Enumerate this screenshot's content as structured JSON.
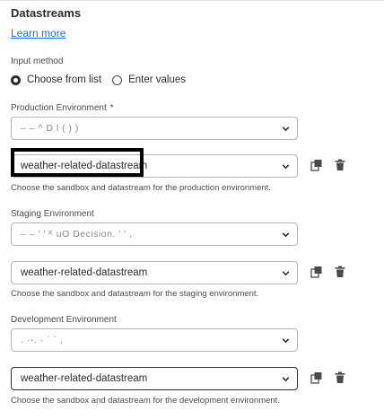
{
  "section": {
    "title": "Datastreams",
    "learn_more": "Learn more"
  },
  "input_method": {
    "label": "Input method",
    "options": [
      {
        "label": "Choose from list",
        "selected": true
      },
      {
        "label": "Enter values",
        "selected": false
      }
    ]
  },
  "production": {
    "label": "Production Environment",
    "required_mark": "*",
    "sandbox_value": "– –                    ^ D               l        (         )    )",
    "datastream_value": "weather-related-datastream",
    "helper": "Choose the sandbox and datastream for the production environment."
  },
  "staging": {
    "label": "Staging Environment",
    "sandbox_value": "– –          '     ' ᴷ uO Decision.      ' '   ,",
    "datastream_value": "weather-related-datastream",
    "helper": "Choose the sandbox and datastream for the staging environment."
  },
  "development": {
    "label": "Development Environment",
    "sandbox_value": "                 .                    ·-.           · ` `  ,",
    "datastream_value": "weather-related-datastream",
    "helper": "Choose the sandbox and datastream for the development environment."
  },
  "icons": {
    "copy": "copy-icon",
    "delete": "trash-icon",
    "dropdown": "chevron-down-icon"
  },
  "colors": {
    "link": "#1473e6",
    "text": "#2c2c2c",
    "border": "#b3b3b3",
    "highlight": "#000000"
  }
}
